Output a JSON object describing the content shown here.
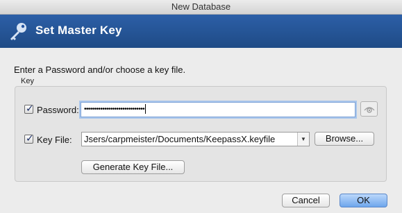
{
  "window": {
    "title": "New Database"
  },
  "banner": {
    "title": "Set Master Key",
    "icon": "key-icon"
  },
  "instruction": "Enter a Password and/or choose a key file.",
  "key_group": {
    "label": "Key",
    "password": {
      "checkbox_checked": true,
      "label": "Password:",
      "value": "••••••••••••••••••••••••••••••",
      "toggle_icon": "eye-icon"
    },
    "key_file": {
      "checkbox_checked": true,
      "label": "Key File:",
      "value": "Jsers/carpmeister/Documents/KeepassX.keyfile",
      "browse_label": "Browse..."
    },
    "generate_label": "Generate Key File..."
  },
  "buttons": {
    "cancel": "Cancel",
    "ok": "OK"
  },
  "colors": {
    "banner": "#2454a0",
    "accent": "#6ea6ec"
  }
}
